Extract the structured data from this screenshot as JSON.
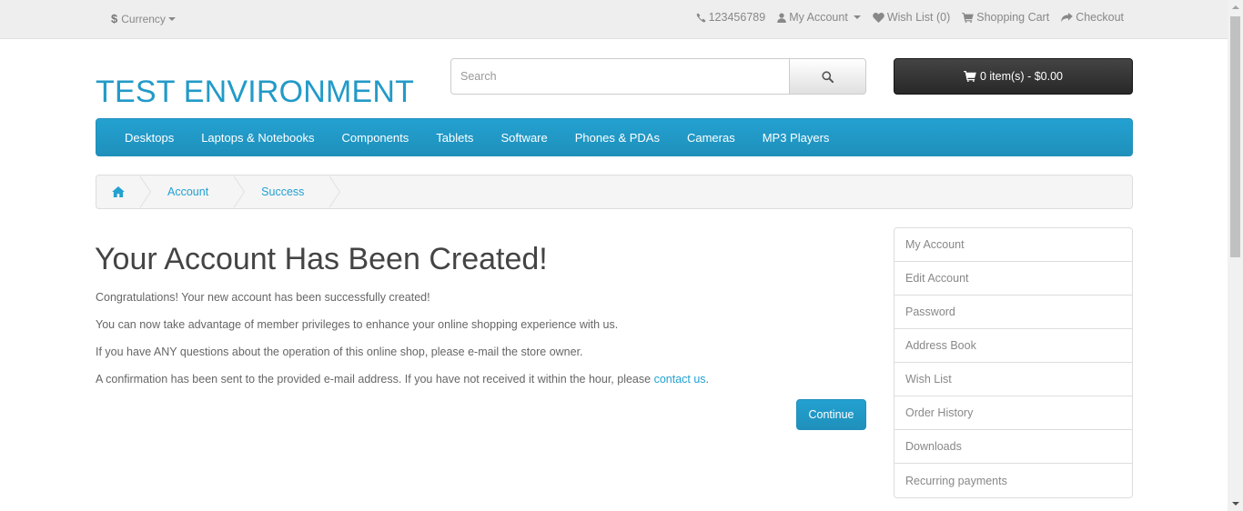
{
  "topbar": {
    "currency_symbol": "$",
    "currency_label": "Currency",
    "phone": "123456789",
    "my_account": "My Account",
    "wishlist": "Wish List (0)",
    "shopping_cart": "Shopping Cart",
    "checkout": "Checkout"
  },
  "header": {
    "logo": "TEST ENVIRONMENT",
    "search_placeholder": "Search",
    "cart_label": "0 item(s) - $0.00"
  },
  "menu": {
    "items": [
      "Desktops",
      "Laptops & Notebooks",
      "Components",
      "Tablets",
      "Software",
      "Phones & PDAs",
      "Cameras",
      "MP3 Players"
    ]
  },
  "breadcrumb": {
    "items": [
      "Account",
      "Success"
    ]
  },
  "content": {
    "title": "Your Account Has Been Created!",
    "p1": "Congratulations! Your new account has been successfully created!",
    "p2": "You can now take advantage of member privileges to enhance your online shopping experience with us.",
    "p3": "If you have ANY questions about the operation of this online shop, please e-mail the store owner.",
    "p4_prefix": "A confirmation has been sent to the provided e-mail address. If you have not received it within the hour, please ",
    "p4_link": "contact us",
    "p4_suffix": ".",
    "continue": "Continue"
  },
  "sidebar": {
    "items": [
      "My Account",
      "Edit Account",
      "Password",
      "Address Book",
      "Wish List",
      "Order History",
      "Downloads",
      "Recurring payments"
    ]
  },
  "colors": {
    "accent": "#229ac8",
    "cart_bg": "#303030",
    "topbar_bg": "#eeeeee"
  }
}
